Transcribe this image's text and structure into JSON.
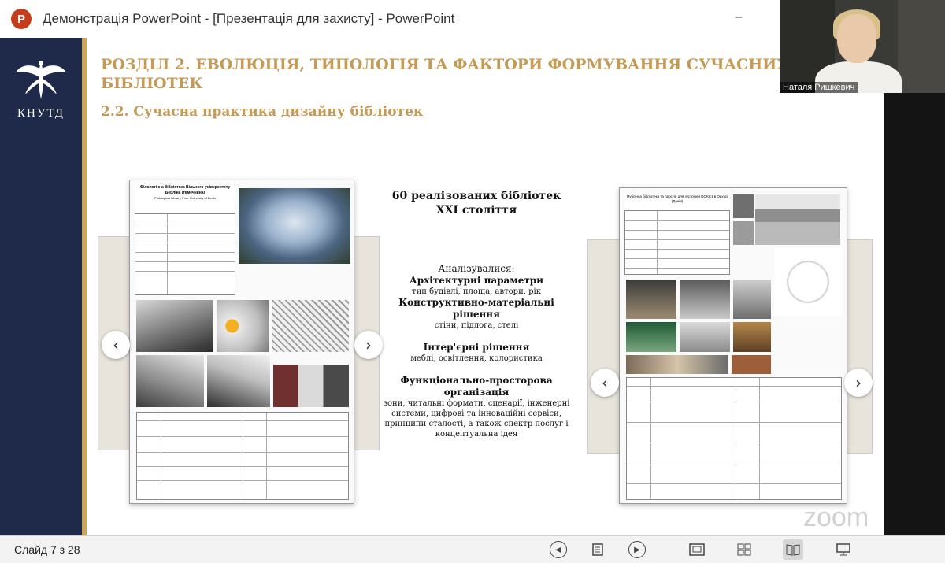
{
  "window": {
    "app_icon_letter": "P",
    "title": "Демонстрація PowerPoint - [Презентація для захисту] - PowerPoint",
    "minimize": "–"
  },
  "slide": {
    "logo_text": "КНУТД",
    "heading": "РОЗДІЛ 2. ЕВОЛЮЦІЯ, ТИПОЛОГІЯ ТА ФАКТОРИ ФОРМУВАННЯ СУЧАСНИХ БІБЛІОТЕК",
    "subheading": "2.2. Сучасна практика дизайну бібліотек",
    "center": {
      "title_line1": "60 реалізованих бібліотек",
      "title_line2": "XXI століття",
      "analyzed": "Аналізувалися:",
      "h1": "Архітектурні параметри",
      "s1": "тип будівлі, площа, автори, рік",
      "h2": "Конструктивно-матеріальні рішення",
      "s2": "стіни, підлога, стелі",
      "h3": "Інтер'єрні рішення",
      "s3": "меблі, освітлення, колористика",
      "h4": "Функціонально-просторова організація",
      "s4": "зони, читальні формати, сценарії, інженерні системи, цифрові та інноваційні сервіси, принципи сталості, а також спектр послуг і концептуальна ідея"
    },
    "left_doc": {
      "title": "Філологічна бібліотека Вільного університету Берліна (Німеччина)",
      "subtitle": "Philological Library, Free University of Berlin"
    },
    "right_doc": {
      "title": "Публічна бібліотека та простір для зустрічей DOKK1 в Орхусі (Данія)"
    },
    "nav": {
      "prev": "‹",
      "next": "›"
    }
  },
  "webcam": {
    "participant_name": "Наталя Ришкевич"
  },
  "watermark": "zoom",
  "statusbar": {
    "slide_counter": "Слайд 7 з 28",
    "buttons": [
      "prev-slide",
      "notes",
      "next-slide",
      "normal-view",
      "slide-sorter",
      "reading-view",
      "slideshow"
    ]
  },
  "colors": {
    "sidebar": "#1f2a4a",
    "gold": "#c49a55",
    "ppt_red": "#c43e1c"
  }
}
